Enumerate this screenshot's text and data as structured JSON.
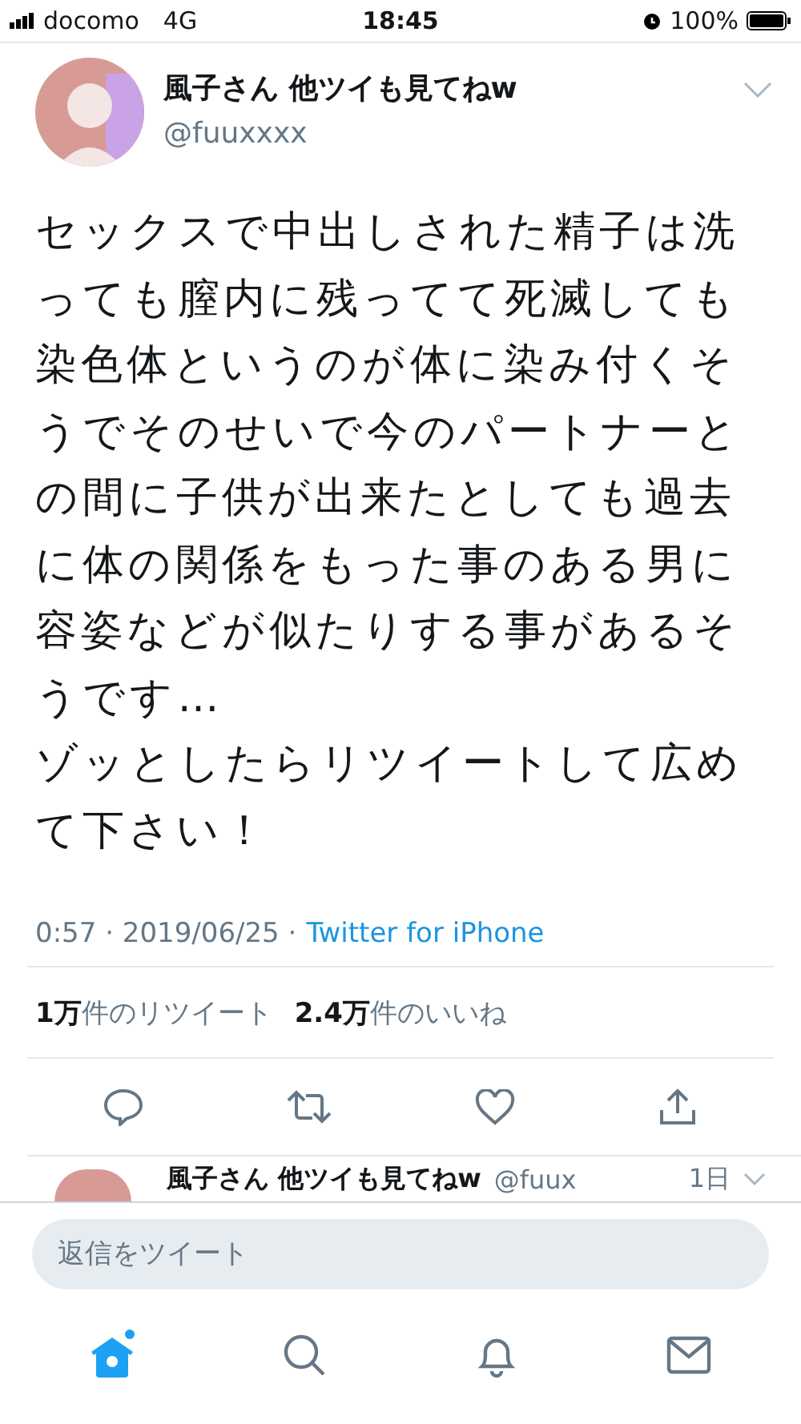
{
  "status_bar": {
    "carrier": "docomo",
    "network": "4G",
    "time": "18:45",
    "battery": "100%"
  },
  "tweet": {
    "name": "風子さん 他ツイも見てねw",
    "handle": "@fuuxxxx",
    "text": "セックスで中出しされた精子は洗っても膣内に残ってて死滅しても染色体というのが体に染み付くそうでそのせいで今のパートナーとの間に子供が出来たとしても過去に体の関係をもった事のある男に容姿などが似たりする事があるそうです…\nゾッとしたらリツイートして広めて下さい！",
    "timestamp": "0:57 · 2019/06/25 ·",
    "source": "Twitter for iPhone",
    "stats": [
      "**1万**件のリツイート",
      "**2.4万**件のいいね"
    ],
    "actions": [
      {
        "kind": "reply"
      },
      {
        "kind": "retweet"
      },
      {
        "kind": "like"
      },
      {
        "kind": "share"
      }
    ]
  },
  "next_tweet": {
    "name": "風子さん 他ツイも見てねw",
    "handle": "@fuux",
    "time": "1日"
  },
  "reply_bar": {
    "placeholder": "返信をツイート"
  },
  "tab_bar": [
    {
      "kind": "home",
      "selected": true
    },
    {
      "kind": "search",
      "selected": false
    },
    {
      "kind": "notifications",
      "selected": false
    },
    {
      "kind": "messages",
      "selected": false
    }
  ]
}
